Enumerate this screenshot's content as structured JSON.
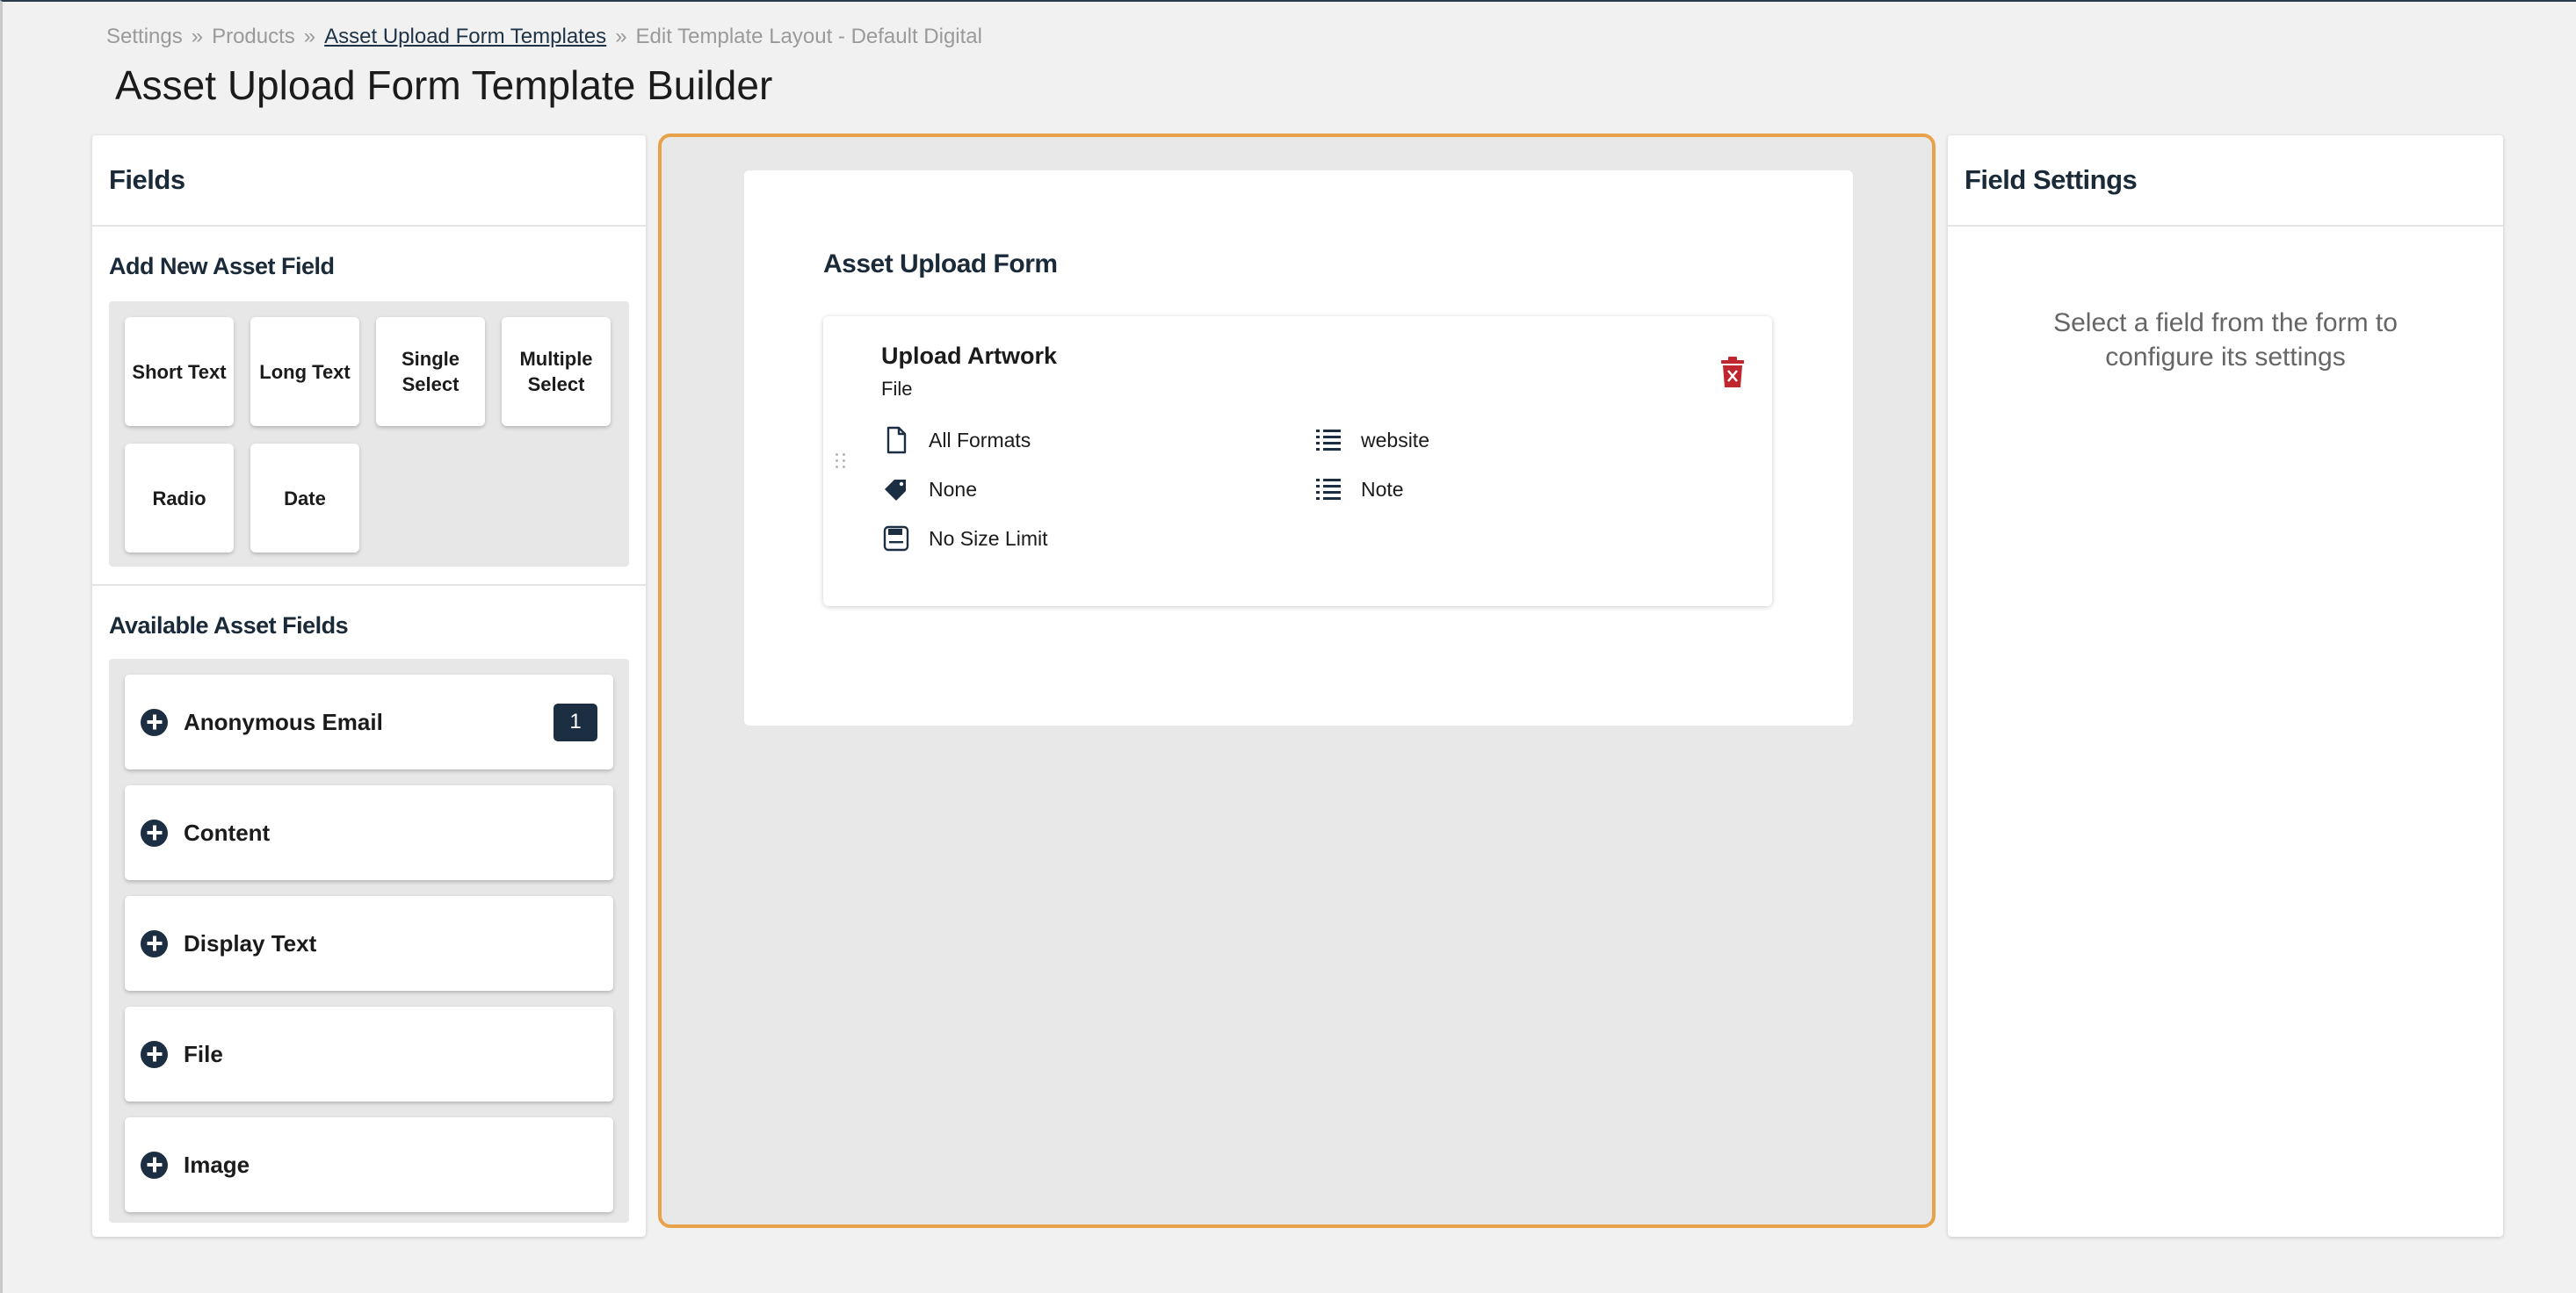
{
  "breadcrumb": {
    "items": [
      "Settings",
      "Products",
      "Asset Upload Form Templates",
      "Edit Template Layout - Default Digital"
    ],
    "separator": "»"
  },
  "page_title": "Asset Upload Form Template Builder",
  "fields_panel": {
    "title": "Fields",
    "add_new_title": "Add New Asset Field",
    "field_types": [
      "Short Text",
      "Long Text",
      "Single Select",
      "Multiple Select",
      "Radio",
      "Date"
    ],
    "available_title": "Available Asset Fields",
    "available_fields": [
      {
        "label": "Anonymous Email",
        "count": "1"
      },
      {
        "label": "Content"
      },
      {
        "label": "Display Text"
      },
      {
        "label": "File"
      },
      {
        "label": "Image"
      }
    ]
  },
  "form": {
    "title": "Asset Upload Form",
    "fields": [
      {
        "name": "Upload Artwork",
        "type": "File",
        "formats": "All Formats",
        "tag": "None",
        "size_limit": "No Size Limit",
        "list_1": "website",
        "list_2": "Note"
      }
    ]
  },
  "settings_panel": {
    "title": "Field Settings",
    "empty_message": "Select a field from the form to configure its settings"
  },
  "colors": {
    "accent_border": "#e8a24a",
    "navy": "#1c2f42",
    "delete_red": "#c0262d"
  },
  "icons": {
    "add": "plus-circle-icon",
    "delete": "trash-icon",
    "formats": "file-icon",
    "tag": "tag-icon",
    "size": "save-icon",
    "list": "list-icon",
    "drag": "drag-handle-icon"
  }
}
